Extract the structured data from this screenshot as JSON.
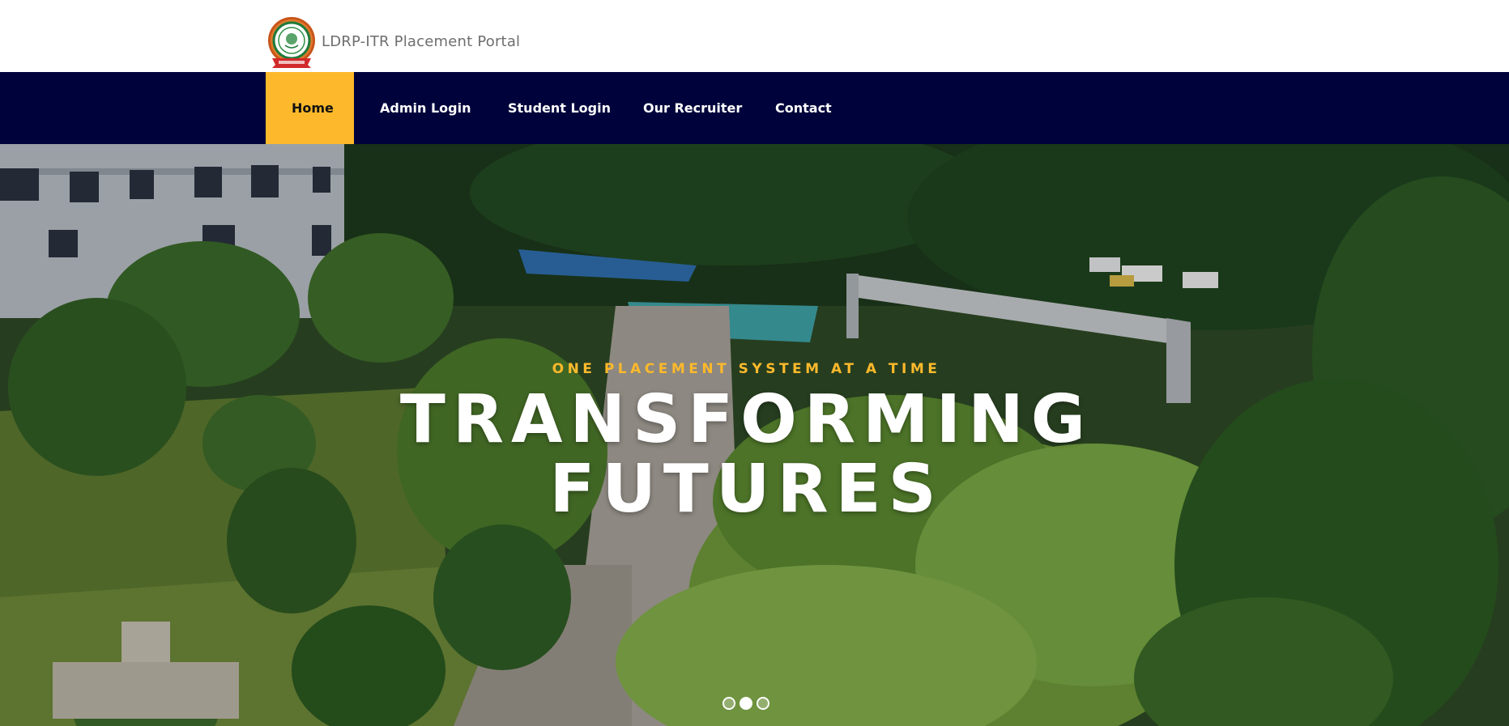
{
  "header": {
    "brand_text": "LDRP-ITR Placement Portal",
    "logo_icon": "college-seal-logo"
  },
  "nav": {
    "items": [
      {
        "label": "Home",
        "active": true
      },
      {
        "label": "Admin Login"
      },
      {
        "label": "Student Login"
      },
      {
        "label": "Our Recruiter"
      },
      {
        "label": "Contact"
      }
    ]
  },
  "hero": {
    "tagline": "ONE PLACEMENT SYSTEM AT A TIME",
    "title": "TRANSFORMING FUTURES",
    "background": "campus-aerial-photo",
    "carousel": {
      "count": 3,
      "active_index": 2
    }
  },
  "colors": {
    "nav_bg": "#00033b",
    "accent": "#fdb92b",
    "brand_text": "#6e6e6e"
  }
}
